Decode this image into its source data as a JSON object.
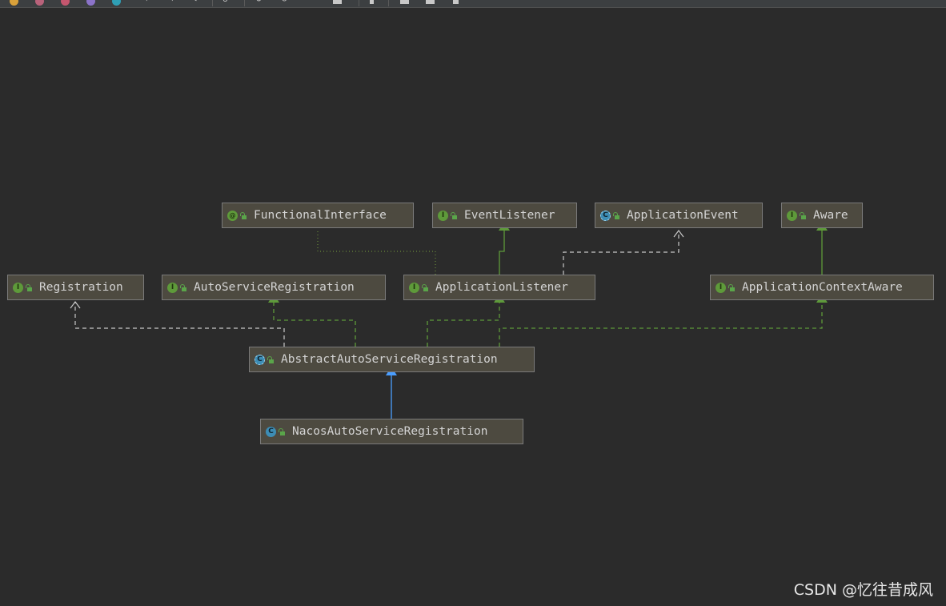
{
  "diagram": {
    "nodes": {
      "functional_interface": {
        "label": "FunctionalInterface",
        "kind": "annotation",
        "badge": "@"
      },
      "event_listener": {
        "label": "EventListener",
        "kind": "interface",
        "badge": "I"
      },
      "application_event": {
        "label": "ApplicationEvent",
        "kind": "abstract-class",
        "badge": "C"
      },
      "aware": {
        "label": "Aware",
        "kind": "interface",
        "badge": "I"
      },
      "registration": {
        "label": "Registration",
        "kind": "interface",
        "badge": "I"
      },
      "auto_service_registration": {
        "label": "AutoServiceRegistration",
        "kind": "interface",
        "badge": "I"
      },
      "application_listener": {
        "label": "ApplicationListener",
        "kind": "interface",
        "badge": "I"
      },
      "application_context_aware": {
        "label": "ApplicationContextAware",
        "kind": "interface",
        "badge": "I"
      },
      "abstract_auto_service_registration": {
        "label": "AbstractAutoServiceRegistration",
        "kind": "abstract-class",
        "badge": "C"
      },
      "nacos_auto_service_registration": {
        "label": "NacosAutoServiceRegistration",
        "kind": "class",
        "badge": "C"
      }
    },
    "edges": [
      {
        "from": "application_listener",
        "to": "event_listener",
        "type": "interface-extends",
        "color": "#5e9a3a"
      },
      {
        "from": "application_listener",
        "to": "application_event",
        "type": "dependency",
        "color": "#c8c8c8"
      },
      {
        "from": "application_listener",
        "to": "functional_interface",
        "type": "annotated-by",
        "color": "#6a8a3a"
      },
      {
        "from": "application_context_aware",
        "to": "aware",
        "type": "interface-extends",
        "color": "#5e9a3a"
      },
      {
        "from": "abstract_auto_service_registration",
        "to": "registration",
        "type": "dependency",
        "color": "#c8c8c8"
      },
      {
        "from": "abstract_auto_service_registration",
        "to": "auto_service_registration",
        "type": "implements",
        "color": "#5e9a3a"
      },
      {
        "from": "abstract_auto_service_registration",
        "to": "application_listener",
        "type": "implements",
        "color": "#5e9a3a"
      },
      {
        "from": "abstract_auto_service_registration",
        "to": "application_context_aware",
        "type": "implements",
        "color": "#5e9a3a"
      },
      {
        "from": "nacos_auto_service_registration",
        "to": "abstract_auto_service_registration",
        "type": "extends",
        "color": "#4a9eff"
      }
    ]
  },
  "watermark": "CSDN @忆往昔成风"
}
